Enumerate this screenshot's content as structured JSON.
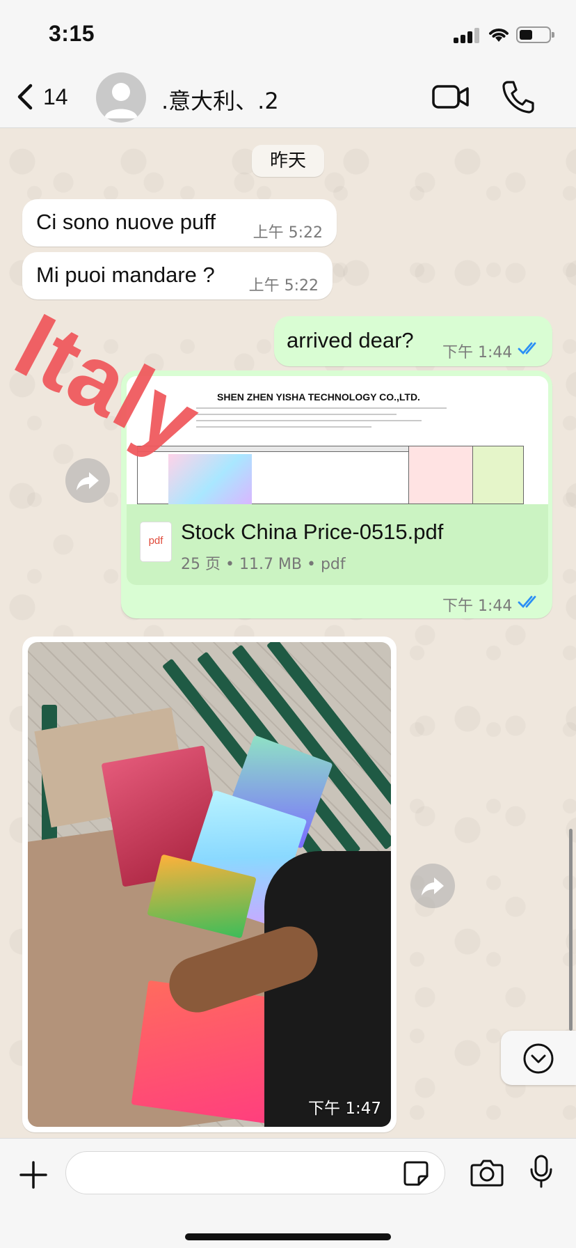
{
  "status_bar": {
    "time": "3:15"
  },
  "header": {
    "back_count": "14",
    "contact_name": ".意大利、.2"
  },
  "day_separator": "昨天",
  "messages": [
    {
      "direction": "in",
      "text": "Ci sono nuove puff",
      "time": "上午 5:22"
    },
    {
      "direction": "in",
      "text": "Mi puoi mandare ?",
      "time": "上午 5:22"
    },
    {
      "direction": "out",
      "text": "arrived dear?",
      "time": "下午 1:44"
    }
  ],
  "document": {
    "preview_company": "SHEN ZHEN YISHA TECHNOLOGY CO.,LTD.",
    "file_icon_label": "pdf",
    "file_name": "Stock China Price-0515.pdf",
    "meta": "25 页 • 11.7 MB • pdf",
    "time": "下午 1:44"
  },
  "image_message": {
    "time": "下午 1:47"
  },
  "stamp_text": "Italy",
  "composer": {
    "placeholder": ""
  },
  "colors": {
    "outgoing": "#d9fdd3",
    "incoming": "#ffffff",
    "read_ticks": "#2b8ff5",
    "stamp": "#f05a5e"
  },
  "icons": [
    "back-chevron-icon",
    "avatar-icon",
    "video-call-icon",
    "phone-icon",
    "forward-icon",
    "chevron-down-icon",
    "plus-icon",
    "sticker-icon",
    "camera-icon",
    "microphone-icon"
  ]
}
